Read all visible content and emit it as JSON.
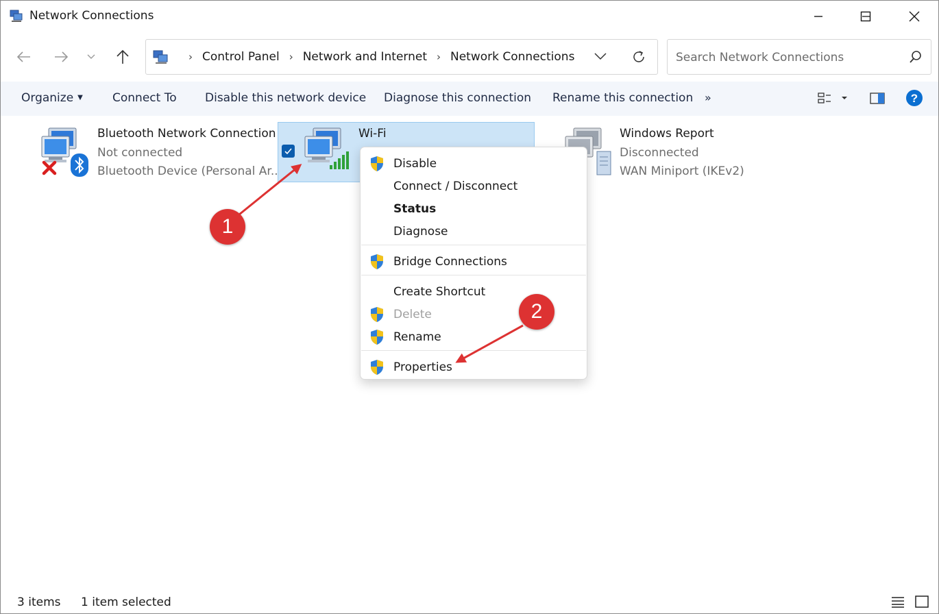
{
  "window": {
    "title": "Network Connections",
    "minimize_icon": "minimize-icon",
    "maximize_icon": "maximize-icon",
    "close_icon": "close-icon"
  },
  "address": {
    "crumbs": [
      "Control Panel",
      "Network and Internet",
      "Network Connections"
    ],
    "search_placeholder": "Search Network Connections"
  },
  "toolbar": {
    "organize": "Organize",
    "connect_to": "Connect To",
    "disable_device": "Disable this network device",
    "diagnose": "Diagnose this connection",
    "rename": "Rename this connection",
    "more": "»"
  },
  "connections": [
    {
      "name": "Bluetooth Network Connection",
      "status": "Not connected",
      "device": "Bluetooth Device (Personal Ar..."
    },
    {
      "name": "Wi-Fi",
      "selected": true
    },
    {
      "name": "Windows Report",
      "status": "Disconnected",
      "device": "WAN Miniport (IKEv2)"
    }
  ],
  "context_menu": {
    "items": [
      {
        "label": "Disable",
        "shield": true
      },
      {
        "label": "Connect / Disconnect",
        "shield": false
      },
      {
        "label": "Status",
        "shield": false,
        "bold": true
      },
      {
        "label": "Diagnose",
        "shield": false
      },
      {
        "label": "Bridge Connections",
        "shield": true
      },
      {
        "label": "Create Shortcut",
        "shield": false
      },
      {
        "label": "Delete",
        "shield": true,
        "disabled": true
      },
      {
        "label": "Rename",
        "shield": true
      },
      {
        "label": "Properties",
        "shield": true
      }
    ]
  },
  "annotations": {
    "step1": "1",
    "step2": "2",
    "color": "#dd3232"
  },
  "status": {
    "items": "3 items",
    "selected": "1 item selected"
  },
  "colors": {
    "selection": "#cce4f7",
    "command_bar": "#f3f6fb",
    "accent": "#0b5cad",
    "help": "#0b6fd1"
  }
}
